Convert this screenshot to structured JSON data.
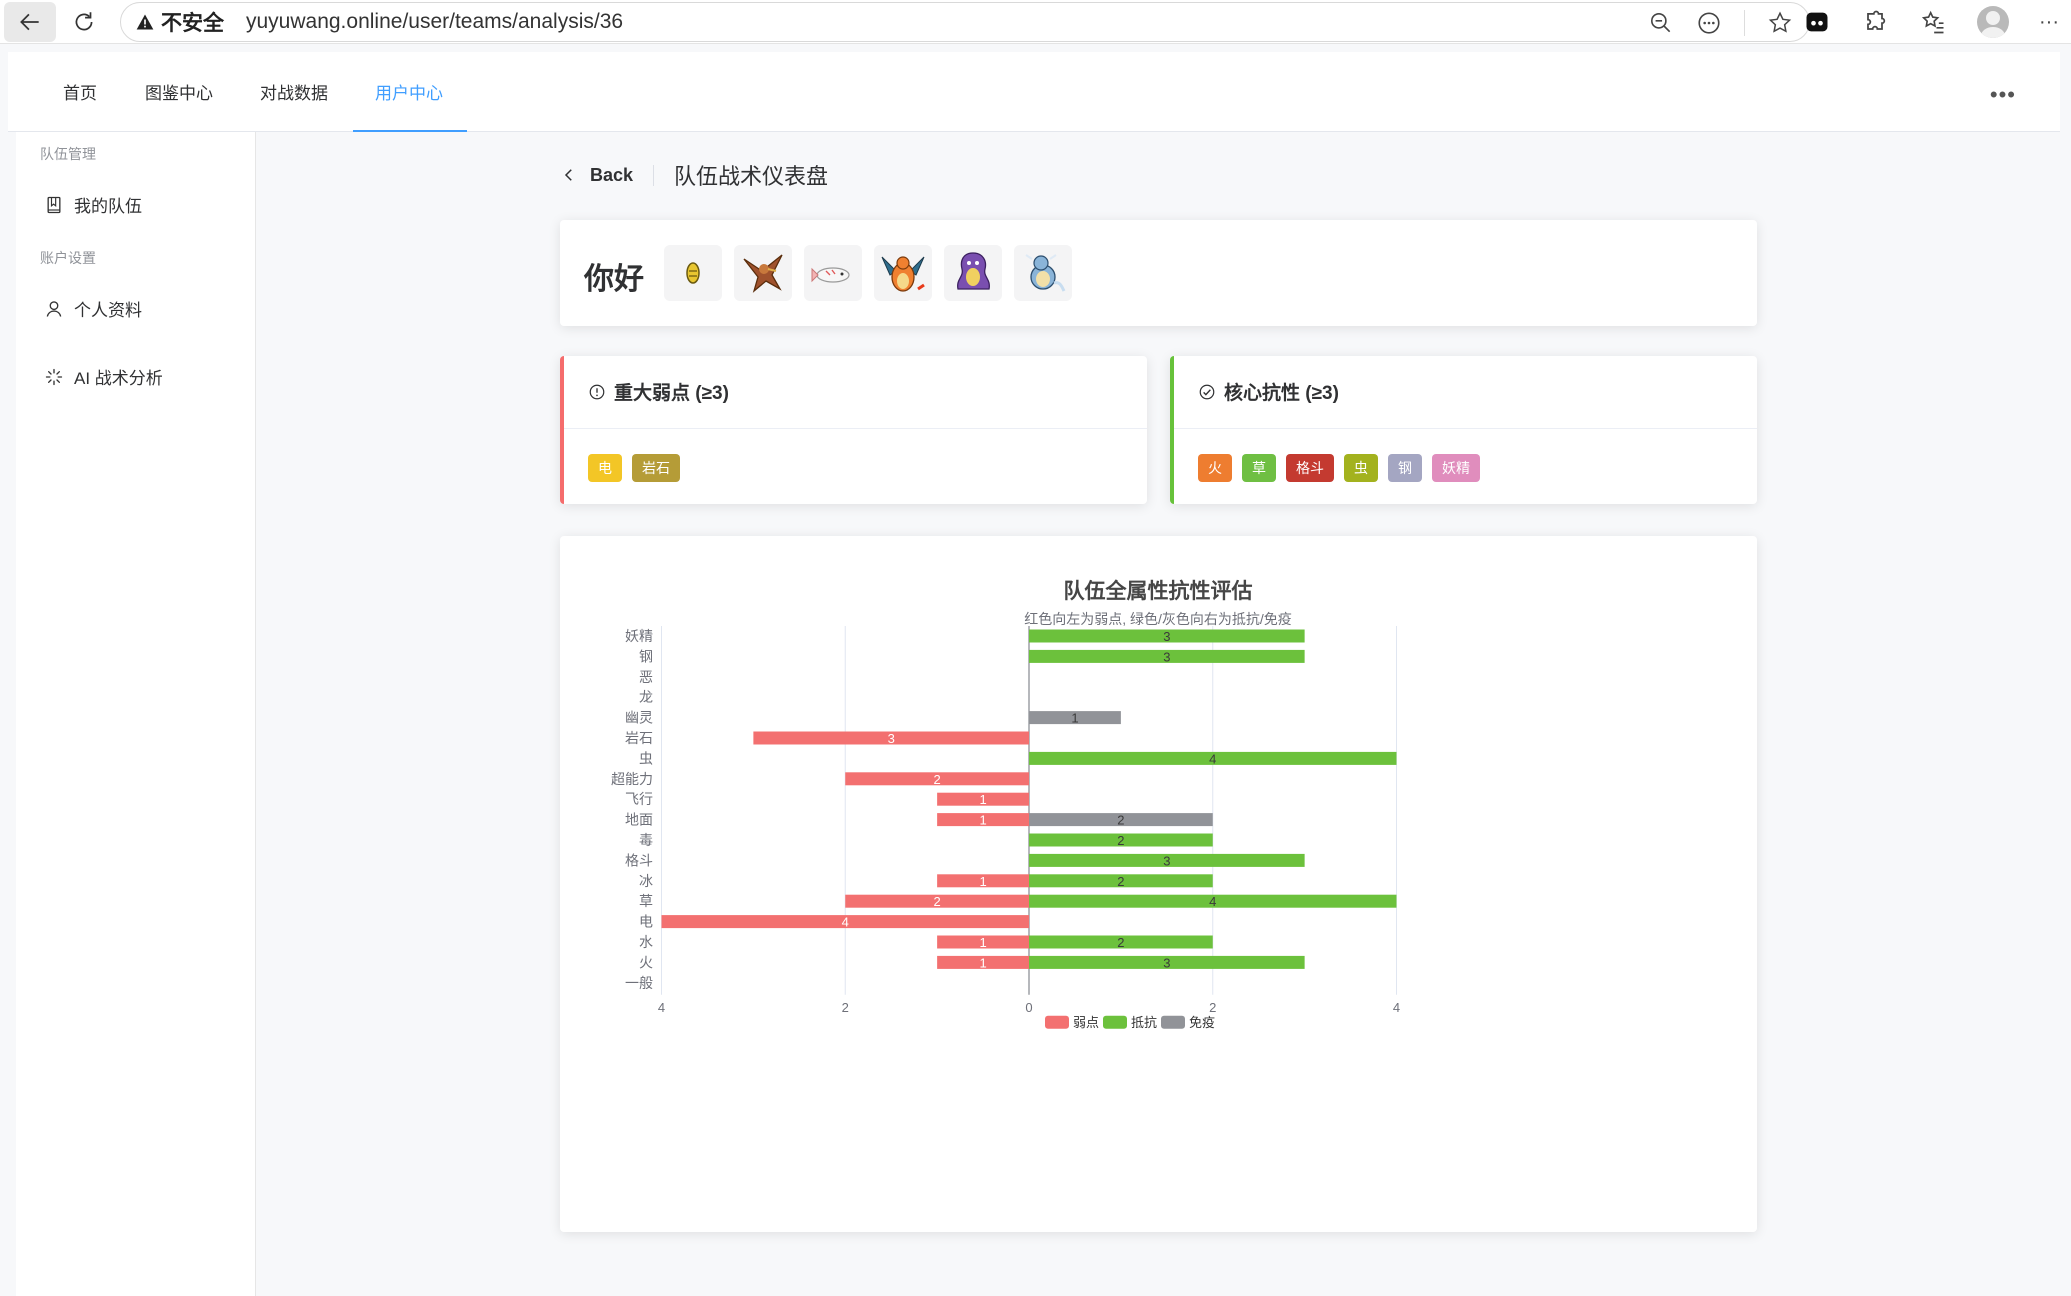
{
  "browser": {
    "security_label": "不安全",
    "url": "yuyuwang.online/user/teams/analysis/36"
  },
  "nav": {
    "items": [
      "首页",
      "图鉴中心",
      "对战数据",
      "用户中心"
    ],
    "active": "用户中心",
    "more": "•••"
  },
  "sidebar": {
    "group1": "队伍管理",
    "my_teams": "我的队伍",
    "group2": "账户设置",
    "profile": "个人资料",
    "ai": "AI 战术分析"
  },
  "header": {
    "back": "Back",
    "title": "队伍战术仪表盘"
  },
  "team": {
    "name": "你好",
    "sprite_icons": [
      "yellow-cocoon-sprite-icon",
      "brown-bird-sprite-icon",
      "white-fish-sprite-icon",
      "charizard-sprite-icon",
      "purple-ghost-sprite-icon",
      "blue-turtle-sprite-icon"
    ]
  },
  "weakness_card": {
    "title": "重大弱点 (≥3)",
    "tags": [
      {
        "label": "电",
        "color": "#f3c626"
      },
      {
        "label": "岩石",
        "color": "#b59c37"
      }
    ]
  },
  "resist_card": {
    "title": "核心抗性 (≥3)",
    "tags": [
      {
        "label": "火",
        "color": "#ee7d30"
      },
      {
        "label": "草",
        "color": "#6fbf43"
      },
      {
        "label": "格斗",
        "color": "#c43a30"
      },
      {
        "label": "虫",
        "color": "#a3b21e"
      },
      {
        "label": "钢",
        "color": "#a4a6c2"
      },
      {
        "label": "妖精",
        "color": "#e08dbd"
      }
    ]
  },
  "chart_data": {
    "type": "bar",
    "orientation": "horizontal-diverging",
    "title": "队伍全属性抗性评估",
    "subtitle": "红色向左为弱点, 绿色/灰色向右为抵抗/免疫",
    "categories": [
      "妖精",
      "钢",
      "恶",
      "龙",
      "幽灵",
      "岩石",
      "虫",
      "超能力",
      "飞行",
      "地面",
      "毒",
      "格斗",
      "冰",
      "草",
      "电",
      "水",
      "火",
      "一般"
    ],
    "series": [
      {
        "name": "弱点",
        "color": "#f37070",
        "direction": "left",
        "values": [
          0,
          0,
          0,
          0,
          0,
          3,
          0,
          2,
          1,
          1,
          0,
          0,
          1,
          2,
          4,
          1,
          1,
          0
        ]
      },
      {
        "name": "抵抗",
        "color": "#6cc13c",
        "direction": "right",
        "values": [
          3,
          3,
          0,
          0,
          0,
          0,
          4,
          0,
          0,
          0,
          2,
          3,
          2,
          4,
          0,
          2,
          3,
          0
        ]
      },
      {
        "name": "免疫",
        "color": "#919398",
        "direction": "right",
        "values": [
          0,
          0,
          0,
          0,
          1,
          0,
          0,
          0,
          0,
          2,
          0,
          0,
          0,
          0,
          0,
          0,
          0,
          0
        ]
      }
    ],
    "x_ticks": [
      "4",
      "2",
      "0",
      "2",
      "4"
    ],
    "xlim": [
      -4,
      4
    ],
    "grid": true,
    "legend": "bottom-center"
  }
}
